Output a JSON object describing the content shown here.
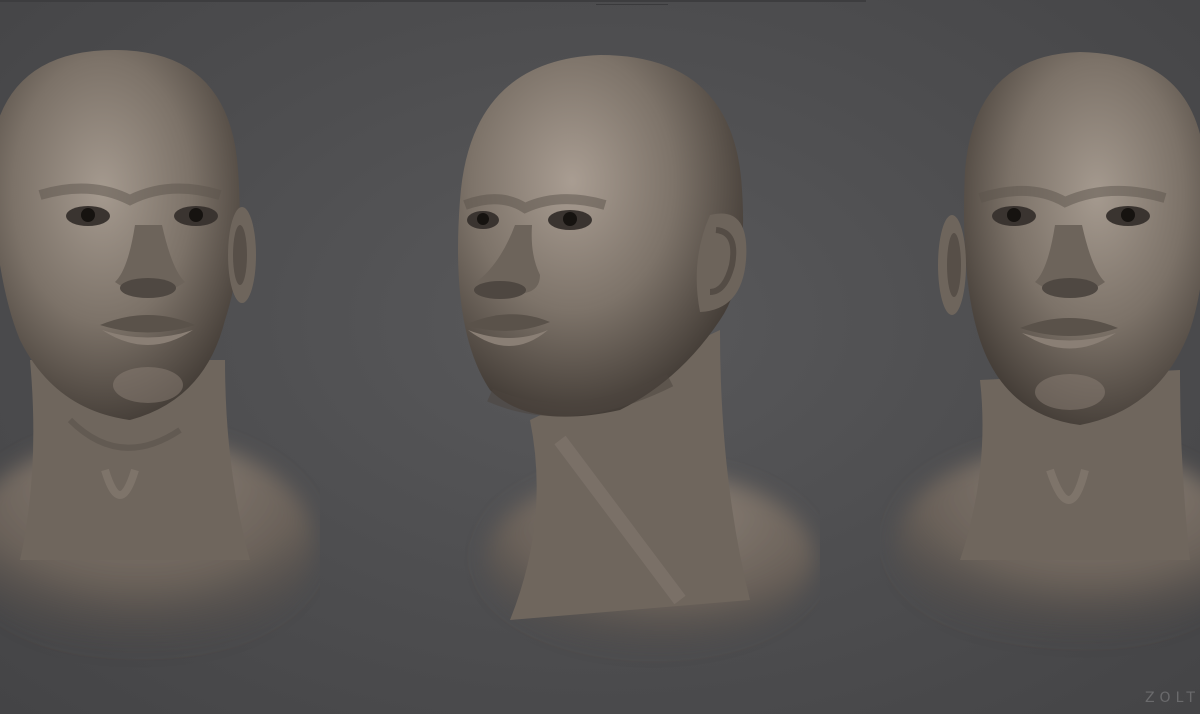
{
  "scene": {
    "background_color": "#4f4f51",
    "clay_color": "#7a7067",
    "clay_shadow": "#3e3833",
    "clay_highlight": "#a3988d"
  },
  "views": [
    {
      "label": "front"
    },
    {
      "label": "three-quarter"
    },
    {
      "label": "front-right"
    }
  ],
  "watermark": {
    "text": "ZOLT"
  }
}
